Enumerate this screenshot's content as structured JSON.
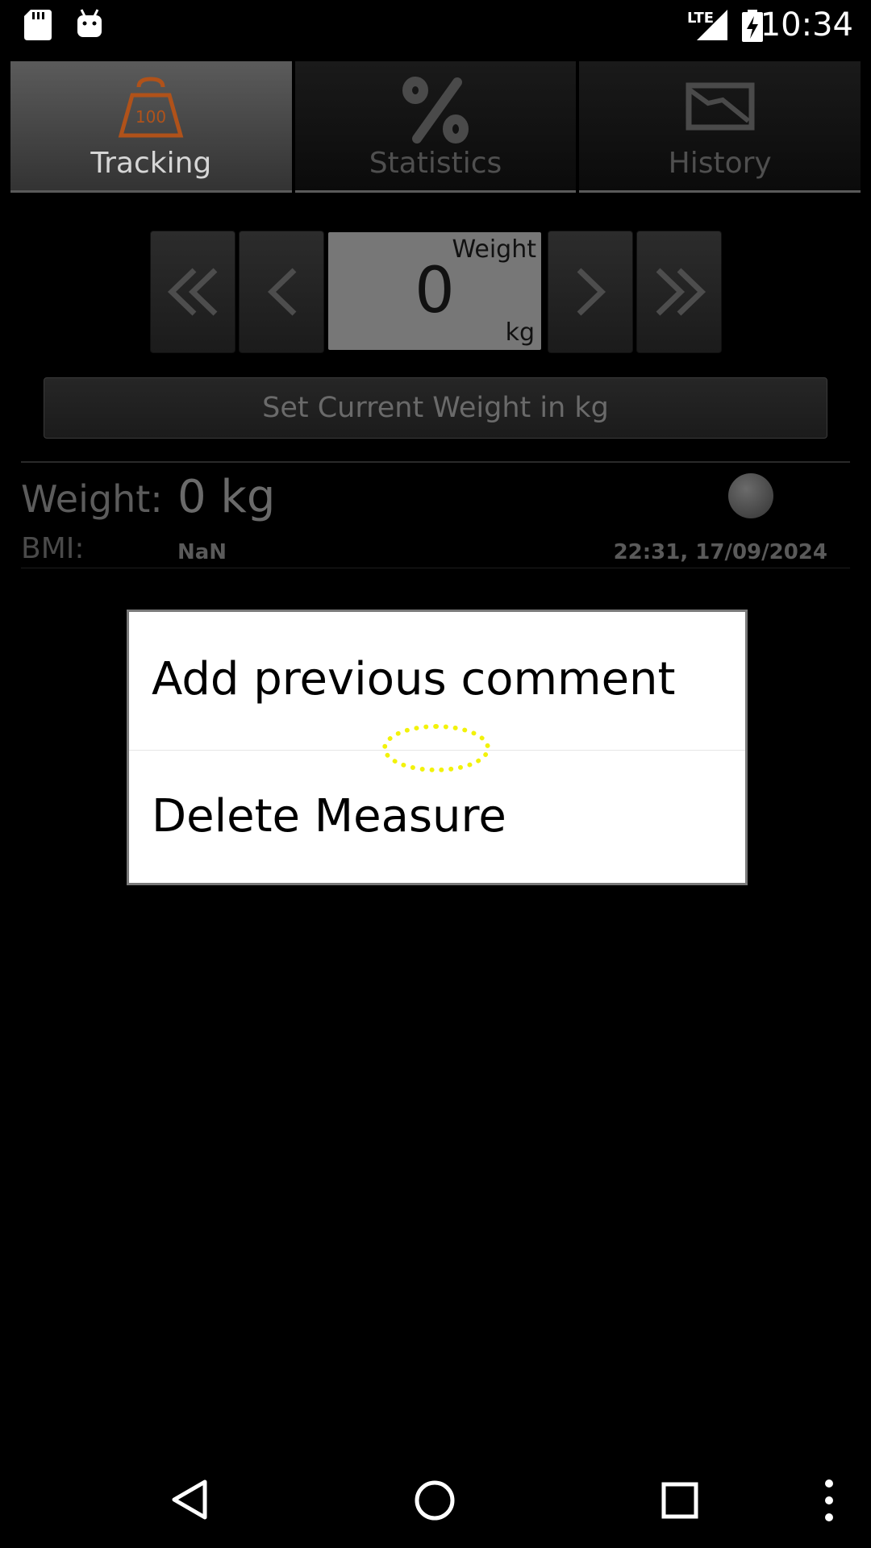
{
  "status_bar": {
    "time": "10:34",
    "network": "LTE",
    "icons": [
      "sd-card-icon",
      "android-icon",
      "signal-icon",
      "battery-charging-icon"
    ]
  },
  "tabs": [
    {
      "label": "Tracking",
      "icon": "scale-weight-icon",
      "active": true
    },
    {
      "label": "Statistics",
      "icon": "percent-icon",
      "active": false
    },
    {
      "label": "History",
      "icon": "history-chart-icon",
      "active": false
    }
  ],
  "picker": {
    "title": "Weight",
    "value": "0",
    "unit": "kg"
  },
  "set_button_label": "Set Current Weight in kg",
  "entry": {
    "weight_label": "Weight:",
    "weight_value": "0 kg",
    "bmi_label": "BMI:",
    "bmi_value": "NaN",
    "timestamp": "22:31, 17/09/2024"
  },
  "dialog": {
    "items": [
      "Add previous comment",
      "Delete Measure"
    ]
  },
  "colors": {
    "active_icon": "#b0521a",
    "background": "#000000",
    "tap_indicator": "#f2f20a"
  }
}
